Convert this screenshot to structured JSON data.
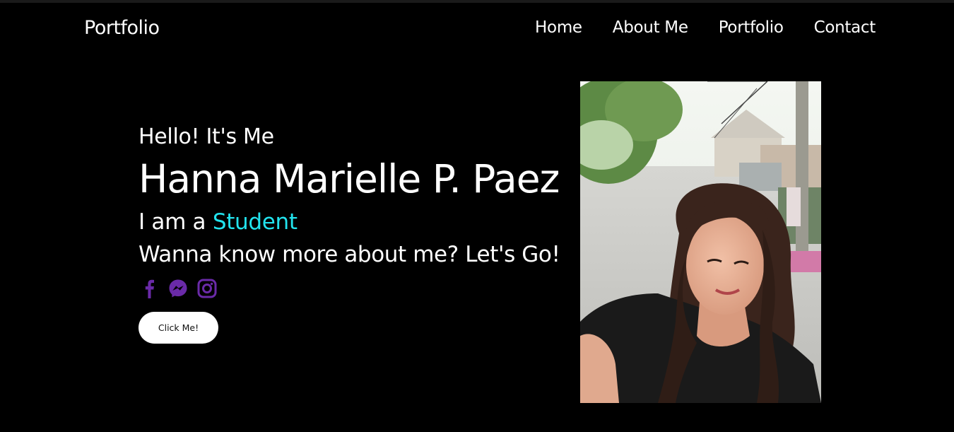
{
  "header": {
    "logo": "Portfolio",
    "nav": [
      "Home",
      "About Me",
      "Portfolio",
      "Contact"
    ]
  },
  "hero": {
    "greeting": "Hello! It's Me",
    "name": "Hanna Marielle P. Paez",
    "role_prefix": "I am a",
    "role_highlight": "Student",
    "cta_text": "Wanna know more about me? Let's Go!",
    "button_label": "Click Me!"
  },
  "socials": [
    "facebook-icon",
    "messenger-icon",
    "instagram-icon"
  ],
  "colors": {
    "background": "#000000",
    "text": "#ffffff",
    "accent": "#22e3ee",
    "social_icon": "#6a2aa8"
  }
}
